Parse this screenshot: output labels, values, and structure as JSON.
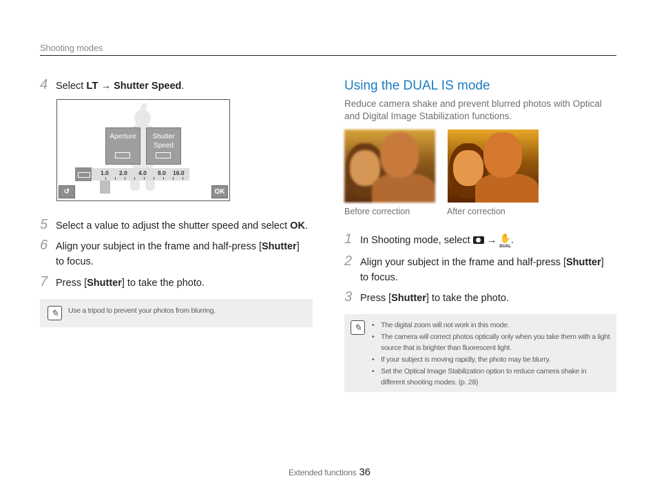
{
  "header": {
    "section": "Shooting modes"
  },
  "left": {
    "step4": {
      "num": "4",
      "pre": "Select ",
      "icon": "LT",
      "arrow": " → ",
      "bold": "Shutter Speed",
      "post": "."
    },
    "illustration": {
      "tile1": "Aperture",
      "tile2a": "Shutter",
      "tile2b": "Speed",
      "scale": [
        "1.0",
        "2.0",
        "4.0",
        "8.0",
        "16.0"
      ],
      "back_icon": "back-arrow-icon",
      "ok_label": "OK"
    },
    "step5": {
      "num": "5",
      "text": "Select a value to adjust the shutter speed and select ",
      "ok": "OK",
      "post": "."
    },
    "step6": {
      "num": "6",
      "pre": "Align your subject in the frame and half-press [",
      "bold": "Shutter",
      "post": "]",
      "line2": "to focus."
    },
    "step7": {
      "num": "7",
      "pre": "Press [",
      "bold": "Shutter",
      "post": "] to take the photo."
    },
    "note": "Use a tripod to prevent your photos from blurring."
  },
  "right": {
    "title": "Using the DUAL IS mode",
    "intro_line1": "Reduce camera shake and prevent blurred photos with Optical",
    "intro_line2": "and Digital Image Stabilization functions.",
    "caption_before": "Before correction",
    "caption_after": "After correction",
    "step1": {
      "num": "1",
      "pre": "In Shooting mode, select ",
      "camera_icon": "camera-icon",
      "arrow": " → ",
      "dual_icon": "dual-is-icon",
      "dual_label": "DUAL",
      "post": "."
    },
    "step2": {
      "num": "2",
      "pre": "Align your subject in the frame and half-press [",
      "bold": "Shutter",
      "post": "]",
      "line2": "to focus."
    },
    "step3": {
      "num": "3",
      "pre": "Press [",
      "bold": "Shutter",
      "post": "] to take the photo."
    },
    "notes": [
      "The digital zoom will not work in this mode.",
      "The camera will correct photos optically only when you take them with a light source that is brighter than fluorescent light.",
      "If your subject is moving rapidly, the photo may be blurry.",
      "Set the Optical Image Stabilization option to reduce camera shake in different shooting modes. (p. 28)"
    ]
  },
  "footer": {
    "label": "Extended functions",
    "page": "36"
  },
  "colors": {
    "accent": "#1a7cbf",
    "note_bg": "#eeeeee",
    "rule": "#231f20"
  }
}
